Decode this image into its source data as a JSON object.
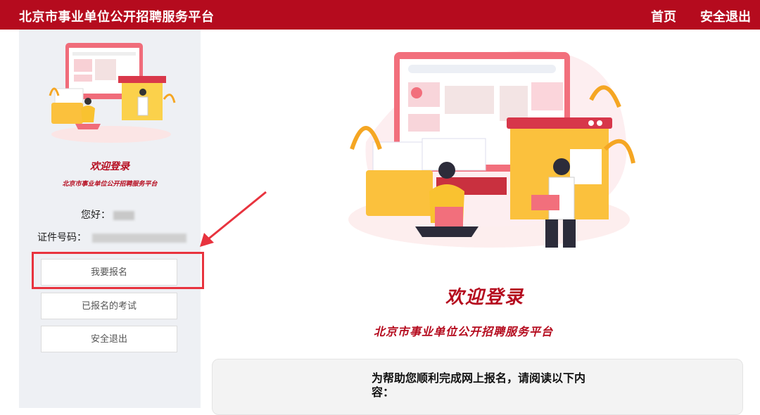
{
  "header": {
    "brand": "北京市事业单位公开招聘服务平台",
    "nav": {
      "home": "首页",
      "logout": "安全退出"
    },
    "background_color": "#b50b1e"
  },
  "sidebar": {
    "welcome_title": "欢迎登录",
    "platform_name": "北京市事业单位公开招聘服务平台",
    "greeting_label": "您好：",
    "id_label": "证件号码：",
    "buttons": [
      {
        "label": "我要报名",
        "highlighted": true
      },
      {
        "label": "已报名的考试"
      },
      {
        "label": "安全退出"
      }
    ]
  },
  "main": {
    "welcome_title": "欢迎登录",
    "platform_name": "北京市事业单位公开招聘服务平台",
    "notice": "为帮助您顺利完成网上报名，请阅读以下内容："
  },
  "colors": {
    "accent": "#b50b1e",
    "highlight_border": "#e8333e",
    "sidebar_bg": "#eef0f4"
  }
}
